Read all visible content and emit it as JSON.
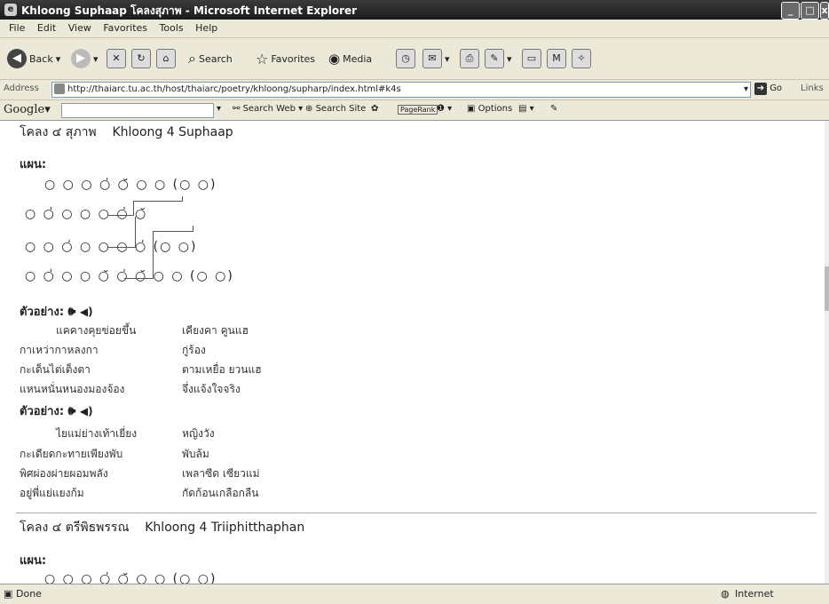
{
  "window": {
    "title": "Khloong Suphaap โคลงสุภาพ - Microsoft Internet Explorer"
  },
  "menu": [
    "File",
    "Edit",
    "View",
    "Favorites",
    "Tools",
    "Help"
  ],
  "toolbar": {
    "back": "Back",
    "search": "Search",
    "favorites": "Favorites",
    "media": "Media"
  },
  "address": {
    "label": "Address",
    "url": "http://thaiarc.tu.ac.th/host/thaiarc/poetry/khloong/supharp/index.html#k4s",
    "go": "Go",
    "links": "Links"
  },
  "google": {
    "logo": "Google",
    "search_web": "Search Web",
    "search_site": "Search Site",
    "pagerank": "PageRank",
    "options": "Options"
  },
  "page": {
    "section1": {
      "thai_title": "โคลง ๔ สุภาพ",
      "roman_title": "Khloong 4 Suphaap",
      "plan_label": "แผน:",
      "plan_lines": [
        "○ ○ ○ ○̍ ○̆      ○ ○     (○ ○)",
        "○ ○̍ ○ ○ ○      ○̍ ○̆",
        "○ ○ ○̍ ○ ○      ○ ○̍     (○ ○)",
        "○ ○̍ ○ ○ ○̆      ○̍ ○̆ ○ ○ (○ ○)"
      ],
      "example_label": "ตัวอย่าง:",
      "example1": [
        [
          "แคคางคุยข่อยขึ้น",
          "เคียงคา คูนแฮ"
        ],
        [
          "กาเหว่ากาหลงกา",
          "กู่ร้อง"
        ],
        [
          "กะเด็นไต่เต็งตา",
          "ตามเหยื่อ ยวนแฮ"
        ],
        [
          "แหนหนั่นหนองมองจ้อง",
          "จึ่งแจ้งใจจริง"
        ]
      ],
      "example2": [
        [
          "ไยแม่ย่างเท้าเยี่ยง",
          "หญิงวัง"
        ],
        [
          "กะเดียดกะทายเพียงพับ",
          "พับล้ม"
        ],
        [
          "พิศผ่องผ่ายผอมพลัง",
          "เพลาซีด เซียวแม่"
        ],
        [
          "อยู่พี่แย่แยงก้ม",
          "กัดก้อนเกลือกลืน"
        ]
      ]
    },
    "section2": {
      "thai_title": "โคลง ๔ ตรีพิธพรรณ",
      "roman_title": "Khloong 4 Triiphitthaphan",
      "plan_label": "แผน:",
      "plan_partial": "○ ○ ○ ○̍ ○̆      ○ ○     (○ ○)"
    }
  },
  "status": {
    "text": "Done",
    "zone": "Internet"
  },
  "colors": {
    "title_bar": "#2b2b2b",
    "chrome": "#ece9d8"
  }
}
